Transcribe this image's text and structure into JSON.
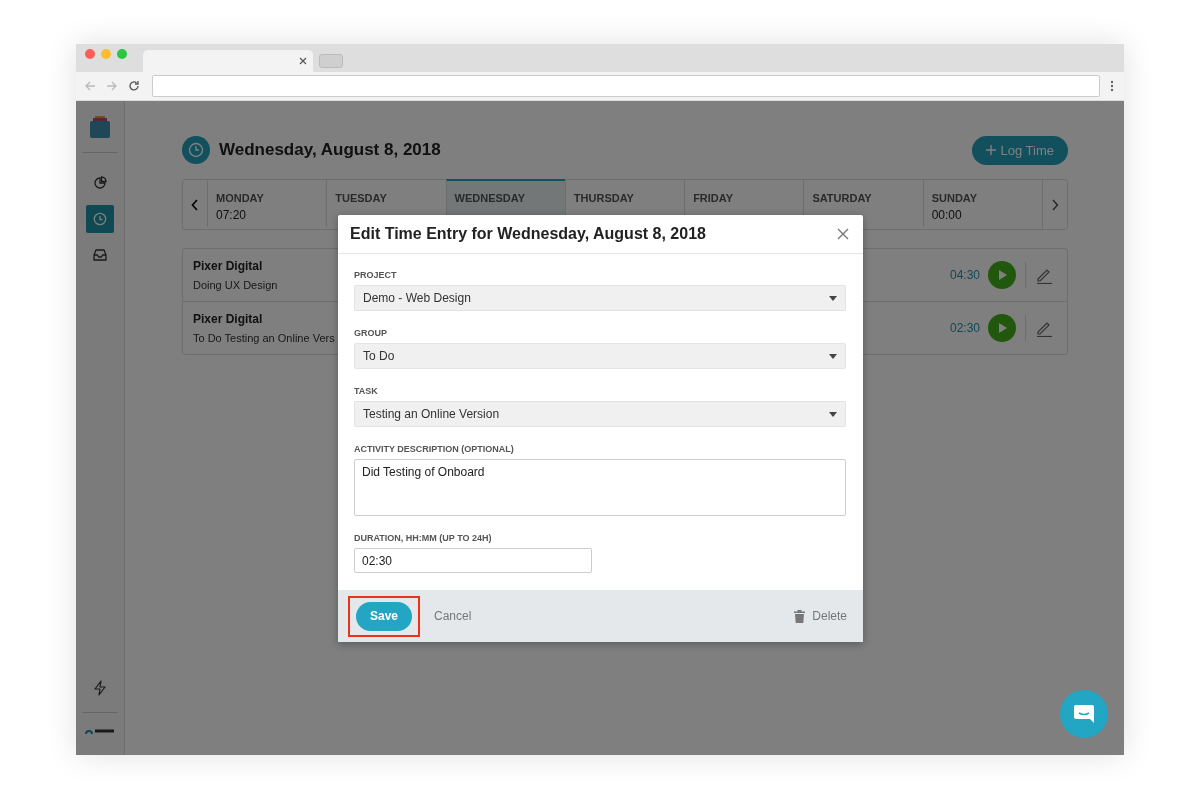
{
  "sidebar": {
    "nav": [
      {
        "selected": false
      },
      {
        "selected": true
      },
      {
        "selected": false
      }
    ]
  },
  "header": {
    "title": "Wednesday, August 8, 2018",
    "log_button": "Log Time"
  },
  "week": [
    {
      "day": "MONDAY",
      "total": "07:20",
      "selected": false
    },
    {
      "day": "TUESDAY",
      "selected": false
    },
    {
      "day": "WEDNESDAY",
      "selected": true
    },
    {
      "day": "THURSDAY",
      "selected": false
    },
    {
      "day": "FRIDAY",
      "selected": false
    },
    {
      "day": "SATURDAY",
      "selected": false
    },
    {
      "day": "SUNDAY",
      "total": "00:00",
      "selected": false
    }
  ],
  "entries": [
    {
      "client": "Pixer Digital",
      "description": "Doing UX Design",
      "duration": "04:30"
    },
    {
      "client": "Pixer Digital",
      "description": "To Do Testing an Online Vers",
      "duration": "02:30"
    }
  ],
  "dialog": {
    "title": "Edit Time Entry for Wednesday, August 8, 2018",
    "fields": [
      {
        "kind": "select",
        "label": "PROJECT",
        "value": "Demo - Web Design"
      },
      {
        "kind": "select",
        "label": "GROUP",
        "value": "To Do"
      },
      {
        "kind": "select",
        "label": "TASK",
        "value": "Testing an Online Version"
      },
      {
        "kind": "textarea",
        "label": "ACTIVITY DESCRIPTION (OPTIONAL)",
        "value": "Did Testing of Onboard"
      },
      {
        "kind": "input",
        "label": "DURATION, HH:MM (UP TO 24H)",
        "value": "02:30"
      }
    ],
    "save": "Save",
    "save_highlighted": true,
    "cancel": "Cancel",
    "delete": "Delete"
  }
}
